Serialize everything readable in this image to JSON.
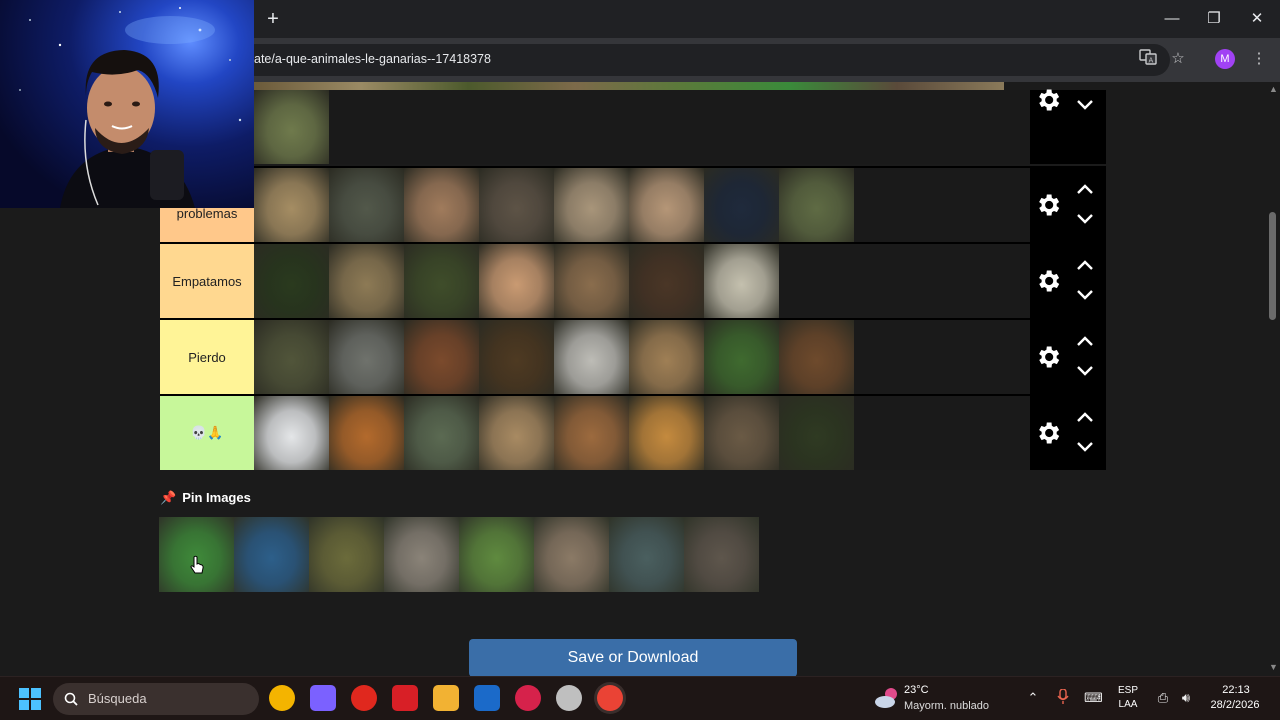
{
  "browser": {
    "new_tab": "+",
    "url": "ate/a-que-animales-le-ganarias--17418378",
    "profile_initial": "M",
    "window_min": "—",
    "window_restore": "❐",
    "window_close": "✕"
  },
  "tiers": [
    {
      "label": "",
      "color": "#1a1a1a",
      "count": 1,
      "palette": [
        "#6f7a4c"
      ]
    },
    {
      "label": "problemas",
      "color": "#ffc88a",
      "count": 8,
      "palette": [
        "#a58d63",
        "#52584a",
        "#a07b5c",
        "#5d5346",
        "#a8957a",
        "#b59677",
        "#1f2a3c",
        "#5f6b44"
      ]
    },
    {
      "label": "Empatamos",
      "color": "#ffd890",
      "count": 7,
      "palette": [
        "#2a3a1e",
        "#8d7a55",
        "#3f4d2a",
        "#c99a72",
        "#8a6d4d",
        "#4a3626",
        "#c4c0ae"
      ]
    },
    {
      "label": "Pierdo",
      "color": "#fff497",
      "count": 8,
      "palette": [
        "#51553a",
        "#6f726c",
        "#7b4a2c",
        "#4e3a22",
        "#bdbcb6",
        "#9f7f55",
        "#3f6a2f",
        "#6e4a2c"
      ]
    },
    {
      "label": "💀🙏",
      "color": "#c7f79a",
      "count": 8,
      "palette": [
        "#e4e6e8",
        "#b36a2c",
        "#5b6a52",
        "#a88a62",
        "#9c6a3e",
        "#c48a3e",
        "#6a5a45",
        "#2f3a22"
      ]
    }
  ],
  "pin": {
    "icon": "📌",
    "title": "Pin Images",
    "palette": [
      "#3f8a3a",
      "#2d5f8a",
      "#6b6b3b",
      "#8a8378",
      "#5f8a3f",
      "#8b7a66",
      "#4a5f5f",
      "#5e564c"
    ]
  },
  "save_button": "Save or Download",
  "taskbar": {
    "search_placeholder": "Búsqueda",
    "weather_temp": "23°C",
    "weather_desc": "Mayorm. nublado",
    "lang_top": "ESP",
    "lang_bottom": "LAA",
    "time": "22:13",
    "date": "28/2/2026",
    "app_colors": [
      "#f4b400",
      "#7b61ff",
      "#e0281e",
      "#d81f26",
      "#f2b233",
      "#1b6ac9",
      "#d6224b",
      "#bfbfbf",
      "#ea4335"
    ]
  }
}
